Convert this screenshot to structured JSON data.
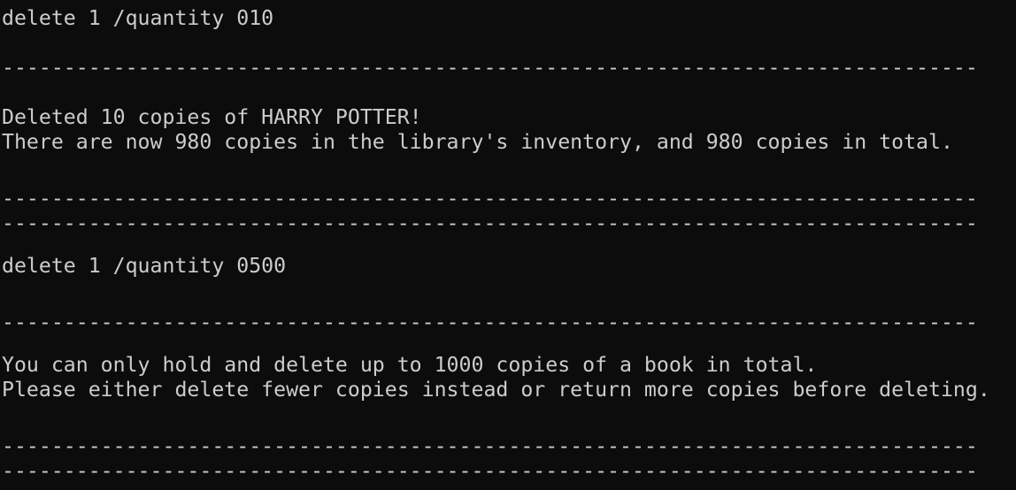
{
  "terminal": {
    "lines": [
      "delete 1 /quantity 010",
      "-------------------------------------------------------------------------------",
      "Deleted 10 copies of HARRY POTTER!",
      "There are now 980 copies in the library's inventory, and 980 copies in total.",
      "-------------------------------------------------------------------------------",
      "-------------------------------------------------------------------------------",
      "delete 1 /quantity 0500",
      "-------------------------------------------------------------------------------",
      "You can only hold and delete up to 1000 copies of a book in total.",
      "Please either delete fewer copies instead or return more copies before deleting.",
      "-------------------------------------------------------------------------------",
      "-------------------------------------------------------------------------------"
    ]
  },
  "colors": {
    "background": "#0c0c0c",
    "text": "#cccccc"
  }
}
